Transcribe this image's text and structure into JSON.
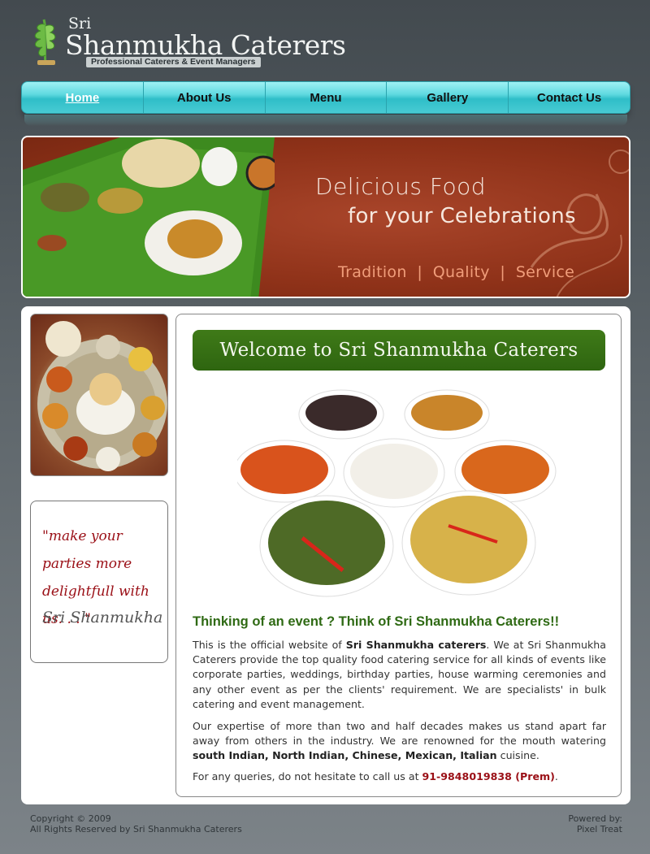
{
  "brand": {
    "sri": "Sri",
    "name": "Shanmukha Caterers",
    "tagline": "Professional Caterers & Event Managers"
  },
  "nav": {
    "items": [
      {
        "label": "Home",
        "active": true
      },
      {
        "label": "About Us"
      },
      {
        "label": "Menu"
      },
      {
        "label": "Gallery"
      },
      {
        "label": "Contact Us"
      }
    ]
  },
  "banner": {
    "line1": "Delicious Food",
    "line2": "for your Celebrations",
    "tags": "Tradition  |  Quality  |  Service"
  },
  "sidebar": {
    "quote": "\"make your parties more delightfull with us. . . \"",
    "signature": "Sri Shanmukha"
  },
  "content": {
    "welcome": "Welcome to Sri Shanmukha Caterers",
    "headline": "Thinking of an event ?  Think of Sri Shanmukha Caterers!!",
    "p1_a": "This is the official website of ",
    "p1_b": "Sri Shanmukha caterers",
    "p1_c": ". We at Sri Shanmukha Caterers provide the top quality food catering service for all kinds of events like corporate parties, weddings, birthday parties, house warming ceremonies and any other event as per the clients' requirement. We are specialists' in bulk catering and event management.",
    "p2_a": "Our expertise of more than two and half decades makes us stand apart far away from others in the industry. We are renowned for the mouth watering ",
    "p2_b": "south Indian, North Indian, Chinese, Mexican, Italian",
    "p2_c": " cuisine.",
    "p3_a": "For any queries, do not hesitate to call us at ",
    "p3_phone": "91-9848019838 (Prem)",
    "p3_c": "."
  },
  "footer": {
    "copyright": "Copyright © 2009",
    "rights": "All Rights Reserved by Sri Shanmukha Caterers",
    "powered_label": "Powered by:",
    "powered_by": "Pixel Treat"
  },
  "colors": {
    "nav_accent": "#2fbec8",
    "welcome_green": "#2e6510",
    "banner_red": "#8f3219",
    "quote_red": "#9a0f16"
  }
}
